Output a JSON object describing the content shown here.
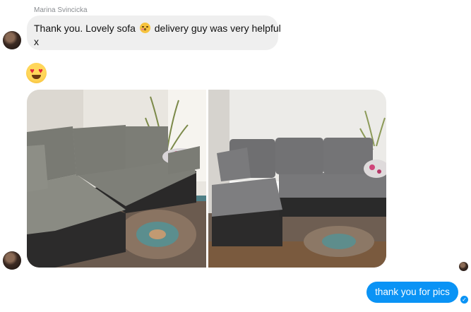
{
  "conversation": {
    "incoming": {
      "sender_name": "Marina Svincicka",
      "message_line1_part1": "Thank you. Lovely sofa",
      "message_line1_emoji": "kissing-blushing-emoji",
      "message_line1_part2": "delivery guy was very helpful",
      "message_line2": "x",
      "reaction_emoji": "heart-eyes-emoji",
      "photos": [
        {
          "name": "sofa-photo-1"
        },
        {
          "name": "sofa-photo-2"
        }
      ]
    },
    "outgoing": {
      "message": "thank you for pics",
      "status_icon": "read-check-icon"
    }
  },
  "colors": {
    "incoming_bubble": "#efefef",
    "outgoing_bubble": "#0a93f5",
    "sender_name": "#8a8d91"
  }
}
